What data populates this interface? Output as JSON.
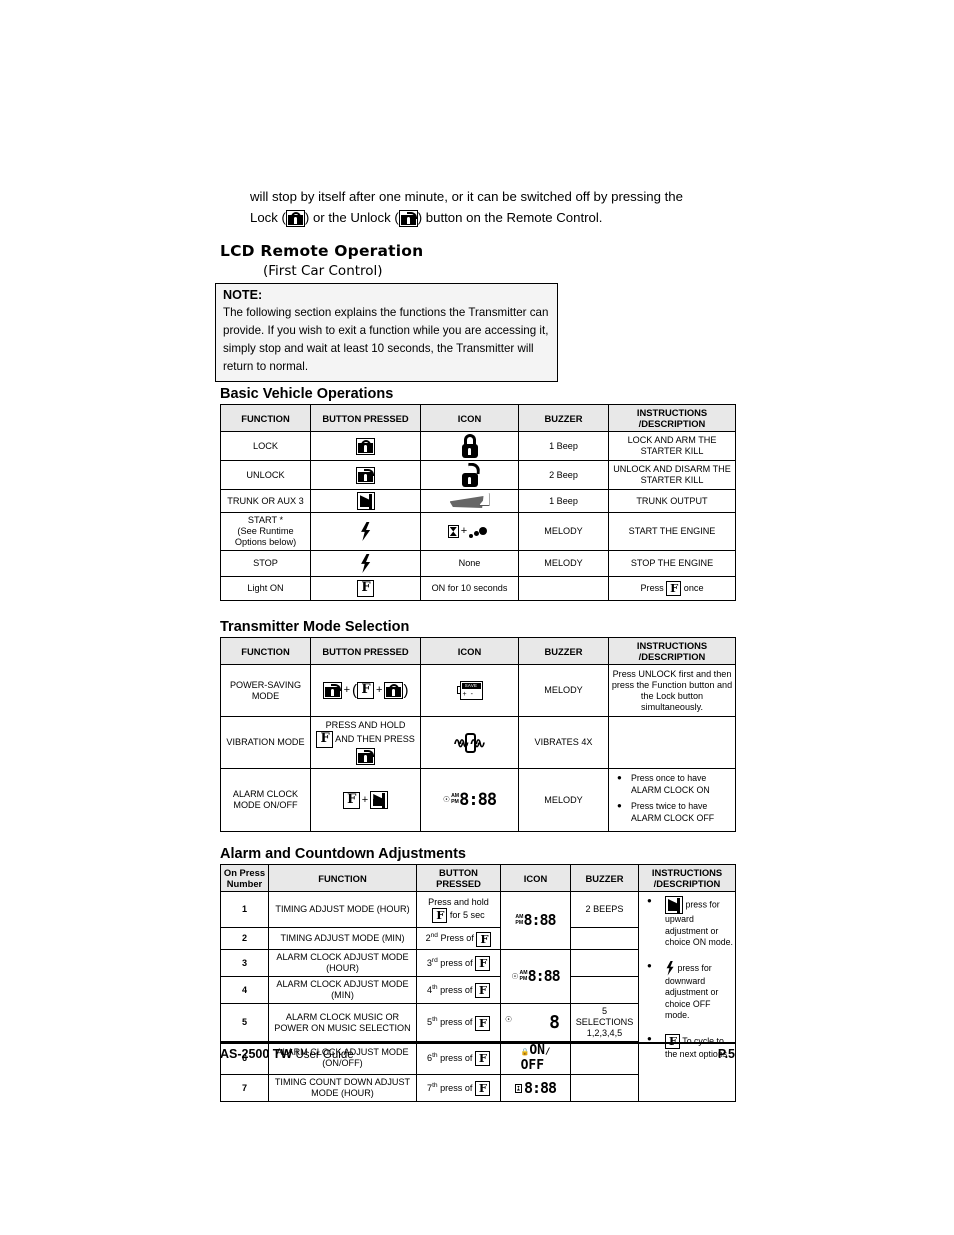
{
  "intro": {
    "line1": "will stop by itself after one minute, or it can be switched off by pressing the",
    "lock_label": "Lock (",
    "mid_label": ") or the Unlock (",
    "end_label": ") button on the Remote Control."
  },
  "section": {
    "title": "LCD Remote Operation",
    "subtitle": "(First Car Control)"
  },
  "note": {
    "label": "NOTE:",
    "body": "The following section explains the functions the Transmitter can provide.  If you wish to exit a function while you are accessing it, simply stop and wait at least 10 seconds, the Transmitter will return to normal."
  },
  "table1": {
    "title": "Basic Vehicle Operations",
    "headers": [
      "FUNCTION",
      "BUTTON PRESSED",
      "ICON",
      "BUZZER",
      "INSTRUCTIONS /DESCRIPTION"
    ],
    "rows": [
      {
        "function": "LOCK",
        "button_icon": "lock-button-icon",
        "icon": "padlock-closed-icon",
        "buzzer": "1 Beep",
        "instructions": "LOCK AND ARM THE STARTER KILL"
      },
      {
        "function": "UNLOCK",
        "button_icon": "unlock-button-icon",
        "icon": "padlock-open-icon",
        "buzzer": "2 Beep",
        "instructions": "UNLOCK AND DISARM THE STARTER KILL"
      },
      {
        "function": "TRUNK OR AUX 3",
        "button_icon": "trunk-button-icon",
        "icon": "trunk-open-icon",
        "buzzer": "1 Beep",
        "instructions": "TRUNK OUTPUT"
      },
      {
        "function": "START *",
        "function_note1": "(See Runtime",
        "function_note2": "Options below)",
        "button_icon": "lightning-bolt-icon",
        "icon": "hourglass-plus-exhaust-icon",
        "buzzer": "MELODY",
        "instructions": "START THE ENGINE"
      },
      {
        "function": "STOP",
        "button_icon": "lightning-bolt-icon",
        "icon": "None",
        "buzzer": "MELODY",
        "instructions": "STOP THE ENGINE"
      },
      {
        "function": "Light ON",
        "button_icon": "function-f-button-icon",
        "icon": "ON for 10 seconds",
        "buzzer": "",
        "instructions_pre": "Press",
        "instructions_post": "once"
      }
    ]
  },
  "table2": {
    "title": "Transmitter Mode Selection",
    "headers": [
      "FUNCTION",
      "BUTTON PRESSED",
      "ICON",
      "BUZZER",
      "INSTRUCTIONS /DESCRIPTION"
    ],
    "rows": [
      {
        "function_l1": "POWER-SAVING",
        "function_l2": "MODE",
        "buzzer": "MELODY",
        "instructions": "Press UNLOCK first and then press the Function button and the Lock button simultaneously."
      },
      {
        "function": "VIBRATION MODE",
        "button_pre": "PRESS AND HOLD",
        "button_mid": "AND THEN PRESS",
        "buzzer": "VIBRATES 4X",
        "instructions": ""
      },
      {
        "function_l1": "ALARM CLOCK",
        "function_l2": "MODE ON/OFF",
        "buzzer": "MELODY",
        "bullets": [
          "Press once to have ALARM CLOCK ON",
          "Press twice to have ALARM CLOCK OFF"
        ]
      }
    ]
  },
  "table3": {
    "title": "Alarm and Countdown Adjustments",
    "headers": [
      "On Press Number",
      "FUNCTION",
      "BUTTON PRESSED",
      "ICON",
      "BUZZER",
      "INSTRUCTIONS /DESCRIPTION"
    ],
    "header_on_press_l1": "On Press",
    "header_on_press_l2": "Number",
    "header_button_l1": "BUTTON",
    "header_button_l2": "PRESSED",
    "header_instr_l1": "INSTRUCTIONS",
    "header_instr_l2": "/DESCRIPTION",
    "rows": [
      {
        "num": "1",
        "function": "TIMING ADJUST MODE (HOUR)",
        "button_pre": "Press and hold",
        "button_post": "for 5 sec",
        "buzzer": "2 BEEPS"
      },
      {
        "num": "2",
        "function": "TIMING ADJUST MODE (MIN)",
        "button_pre": "2",
        "button_ord": "nd",
        "button_mid": "Press of",
        "buzzer": ""
      },
      {
        "num": "3",
        "function_l1": "ALARM CLOCK ADJUST MODE",
        "function_l2": "(HOUR)",
        "button_pre": "3",
        "button_ord": "rd",
        "button_mid": "press of",
        "buzzer": ""
      },
      {
        "num": "4",
        "function_l1": "ALARM CLOCK ADJUST MODE",
        "function_l2": "(MIN)",
        "button_pre": "4",
        "button_ord": "th",
        "button_mid": "press of",
        "buzzer": ""
      },
      {
        "num": "5",
        "function_l1": "ALARM CLOCK MUSIC OR",
        "function_l2": "POWER ON MUSIC SELECTION",
        "button_pre": "5",
        "button_ord": "th",
        "button_mid": "press of",
        "buzzer_l1": "5",
        "buzzer_l2": "SELECTIONS",
        "buzzer_l3": "1,2,3,4,5"
      },
      {
        "num": "6",
        "function_l1": "ALARM CLOCK ADJUST MODE",
        "function_l2": "(ON/OFF)",
        "button_pre": "6",
        "button_ord": "th",
        "button_mid": "press of",
        "buzzer": ""
      },
      {
        "num": "7",
        "function_l1": "TIMING COUNT DOWN ADJUST",
        "function_l2": "MODE (HOUR)",
        "button_pre": "7",
        "button_ord": "th",
        "button_mid": "press of",
        "buzzer": ""
      }
    ],
    "instructions": {
      "b1_text": "press for upward adjustment or choice ON mode.",
      "b2_text": "press for downward adjustment or choice OFF mode.",
      "b3_text": "To cycle to the next options"
    }
  },
  "lcd": {
    "digits_time": "8:88",
    "digits_single": "8",
    "on_text": "ON",
    "off_text": "OFF",
    "am_label": "AM",
    "pm_label": "PM",
    "save_word": "SAVE"
  },
  "footer": {
    "model": "AS-2500 TW",
    "guide": "User Guide",
    "page": "P.5"
  }
}
